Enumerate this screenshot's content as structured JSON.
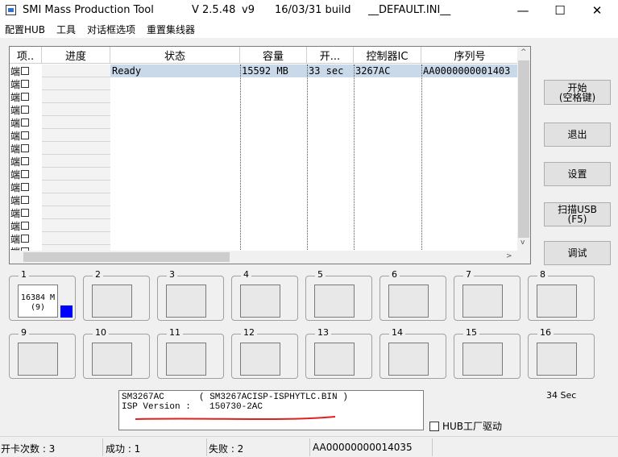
{
  "window": {
    "app_name": "SMI Mass Production Tool",
    "version": "V 2.5.48",
    "build_tag": "v9",
    "build": "16/03/31 build",
    "ini": "__DEFAULT.INI__",
    "controls": {
      "minimize": "—",
      "maximize": "☐",
      "close": "✕"
    }
  },
  "menu": [
    "配置HUB",
    "工具",
    "对话框选项",
    "重置集线器"
  ],
  "list": {
    "columns": [
      "项..",
      "进度",
      "状态",
      "容量",
      "开...",
      "控制器IC",
      "序列号"
    ],
    "item_label": "端",
    "item_rows": 16,
    "row": {
      "status": "Ready",
      "capacity": "15592 MB",
      "time": "33 sec",
      "controller": "3267AC",
      "serial": "AA0000000001403"
    },
    "scroll": {
      "up": "^",
      "down": "v",
      "right": ">"
    }
  },
  "buttons": {
    "start": "开始\n(空格键)",
    "exit": "退出",
    "settings": "设置",
    "scan": "扫描USB\n(F5)",
    "debug": "调试"
  },
  "slots": [
    {
      "n": "1",
      "text": "16384 M\n(9)",
      "active": true,
      "indicator_color": "#0000ff"
    },
    {
      "n": "2"
    },
    {
      "n": "3"
    },
    {
      "n": "4"
    },
    {
      "n": "5"
    },
    {
      "n": "6"
    },
    {
      "n": "7"
    },
    {
      "n": "8"
    },
    {
      "n": "9"
    },
    {
      "n": "10"
    },
    {
      "n": "11"
    },
    {
      "n": "12"
    },
    {
      "n": "13"
    },
    {
      "n": "14"
    },
    {
      "n": "15"
    },
    {
      "n": "16"
    }
  ],
  "info": {
    "line1_left": "SM3267AC",
    "line1_right": "( SM3267ACISP-ISPHYTLC.BIN )",
    "line2_left": "ISP Version :",
    "line2_right": "150730-2AC",
    "underline_color": "#e02020"
  },
  "elapsed": "34 Sec",
  "hub_driver": {
    "label": "HUB工厂驱动",
    "checked": false
  },
  "status": {
    "open_count": "开卡次数 : 3",
    "success": "成功 : 1",
    "fail": "失败 : 2",
    "serial": "AA00000000014035"
  }
}
